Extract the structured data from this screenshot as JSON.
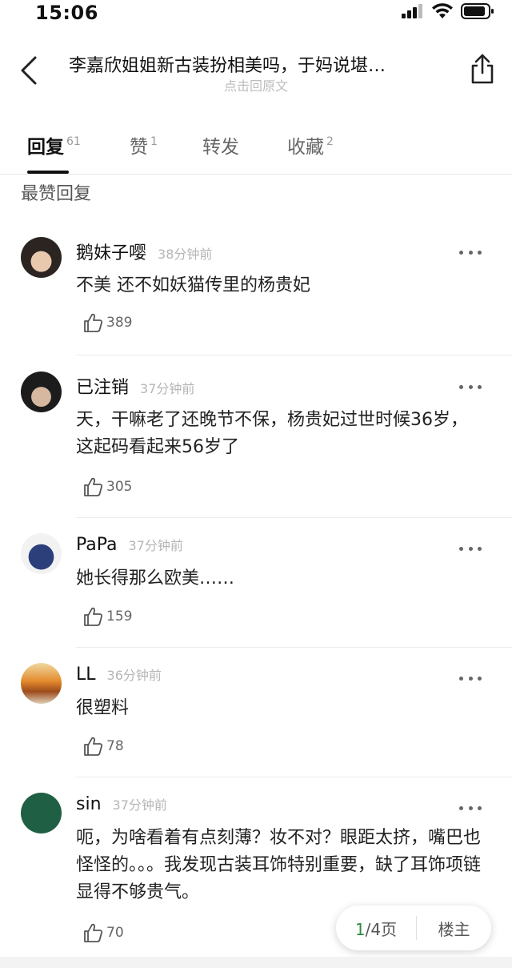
{
  "status": {
    "time": "15:06"
  },
  "nav": {
    "title": "李嘉欣姐姐新古装扮相美吗，于妈说堪…",
    "subtitle": "点击回原文"
  },
  "tabs": [
    {
      "label": "回复",
      "count": "61"
    },
    {
      "label": "赞",
      "count": "1"
    },
    {
      "label": "转发",
      "count": ""
    },
    {
      "label": "收藏",
      "count": "2"
    }
  ],
  "section_title": "最赞回复",
  "comments": [
    {
      "user": "鹅妹子嘤",
      "time": "38分钟前",
      "text": "不美 还不如妖猫传里的杨贵妃",
      "likes": "389"
    },
    {
      "user": "已注销",
      "time": "37分钟前",
      "text": "天，干嘛老了还晚节不保，杨贵妃过世时候36岁，这起码看起来56岁了",
      "likes": "305"
    },
    {
      "user": "PaPa",
      "time": "37分钟前",
      "text": "她长得那么欧美……",
      "likes": "159"
    },
    {
      "user": "LL",
      "time": "36分钟前",
      "text": "很塑料",
      "likes": "78"
    },
    {
      "user": "sin",
      "time": "37分钟前",
      "text": "呃，为啥看着有点刻薄？妆不对？眼距太挤，嘴巴也怪怪的。。。我发现古装耳饰特别重要，缺了耳饰项链显得不够贵气。",
      "likes": "70"
    }
  ],
  "pager": {
    "current": "1",
    "total_text": "/4页",
    "host_label": "楼主"
  },
  "colors": {
    "accent_green": "#2f8a3f",
    "tab_indicator": "#111111"
  }
}
